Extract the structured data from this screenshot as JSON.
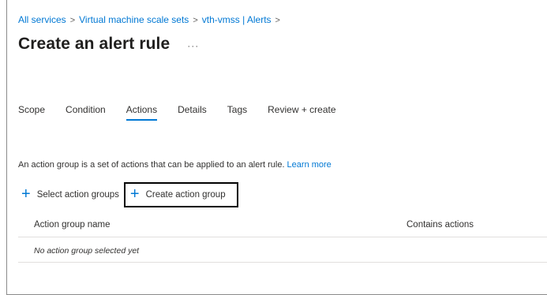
{
  "breadcrumb": {
    "items": [
      "All services",
      "Virtual machine scale sets",
      "vth-vmss | Alerts"
    ],
    "separator": ">"
  },
  "page": {
    "title": "Create an alert rule",
    "more_label": "···"
  },
  "tabs": [
    {
      "label": "Scope",
      "active": false
    },
    {
      "label": "Condition",
      "active": false
    },
    {
      "label": "Actions",
      "active": true
    },
    {
      "label": "Details",
      "active": false
    },
    {
      "label": "Tags",
      "active": false
    },
    {
      "label": "Review + create",
      "active": false
    }
  ],
  "description": {
    "text": "An action group is a set of actions that can be applied to an alert rule.",
    "link": "Learn more"
  },
  "commands": {
    "select_label": "Select action groups",
    "create_label": "Create action group",
    "plus_icon": "+"
  },
  "table": {
    "columns": [
      "Action group name",
      "Contains actions"
    ],
    "empty_text": "No action group selected yet"
  },
  "colors": {
    "accent": "#0078d4",
    "text": "#323130"
  }
}
